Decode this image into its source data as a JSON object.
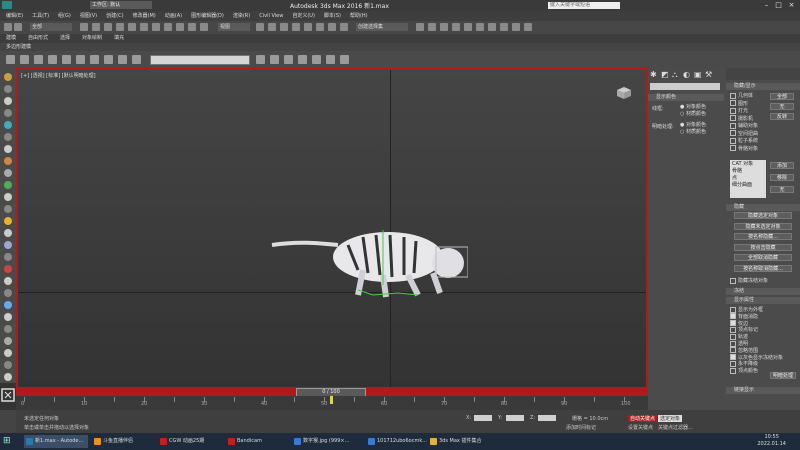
{
  "app": {
    "title": "Autodesk 3ds Max 2016    新1.max",
    "workspace_label": "工作区: 默认",
    "search_placeholder": "键入关键字或短语"
  },
  "menu": [
    "编辑(E)",
    "工具(T)",
    "组(G)",
    "视图(V)",
    "创建(C)",
    "修改器(M)",
    "动画(A)",
    "图形编辑器(D)",
    "渲染(R)",
    "Civil View",
    "自定义(U)",
    "脚本(S)",
    "帮助(H)"
  ],
  "toolbar1": {
    "select_value": "全部",
    "view_value": "视图",
    "selection_set": "创建选择集"
  },
  "ribbon_tabs": [
    "建模",
    "自由形式",
    "选择",
    "对象绘制",
    "填充"
  ],
  "subbar_label": "多边形建模",
  "viewport": {
    "label": "[+] [透视] [标准] [默认明暗处理]",
    "accent": "#b01a1a"
  },
  "timeline": {
    "slider_label": "0 / 100",
    "ticks": [
      "0",
      "5",
      "10",
      "15",
      "20",
      "25",
      "30",
      "35",
      "40",
      "45",
      "50",
      "55",
      "60",
      "65",
      "70",
      "75",
      "80",
      "85",
      "90",
      "95",
      "100"
    ]
  },
  "status": {
    "line1": "未选定任何对象",
    "line2": "单击或单击并拖动以选择对象",
    "x_label": "X:",
    "y_label": "Y:",
    "z_label": "Z:",
    "grid": "栅格 = 10.0cm",
    "add_time_tag": "添加时间标记",
    "auto_key": "自动关键点",
    "selected": "选定对象",
    "set_key": "设置关键点",
    "key_filter": "关键点过滤器..."
  },
  "command_panel": {
    "rollout_title": "显示颜色",
    "wire_label": "线框:",
    "shaded_label": "明暗处理:",
    "opt_object_color": "对象颜色",
    "opt_material_color": "材质颜色"
  },
  "right_panel": {
    "section1_title": "隐藏/显示",
    "items1": [
      "几何体",
      "图形",
      "灯光",
      "摄影机",
      "辅助对象",
      "空间扭曲",
      "粒子系统",
      "骨骼对象"
    ],
    "btn_all": "全部",
    "btn_none": "无",
    "btn_invert": "反转",
    "list_head": "CAT 对象",
    "list_items": [
      "骨骼",
      "点",
      "细分曲面"
    ],
    "btn_add": "添加",
    "btn_remove": "移除",
    "btn_none2": "无",
    "section2_title": "隐藏",
    "hide_buttons": [
      "隐藏选定对象",
      "隐藏未选定对象",
      "按名称隐藏...",
      "按点击隐藏",
      "全部取消隐藏",
      "按名称取消隐藏..."
    ],
    "freeze_title": "隐藏冻结对象",
    "section3_title": "冻结",
    "section4_title": "显示属性",
    "display_props": [
      {
        "label": "显示为外框",
        "checked": false
      },
      {
        "label": "背面消隐",
        "checked": true
      },
      {
        "label": "仅边",
        "checked": true
      },
      {
        "label": "顶点标记",
        "checked": false
      },
      {
        "label": "轨迹",
        "checked": false
      },
      {
        "label": "透明",
        "checked": false
      },
      {
        "label": "忽略范围",
        "checked": false
      },
      {
        "label": "以灰色显示冻结对象",
        "checked": true
      },
      {
        "label": "永不降级",
        "checked": false
      },
      {
        "label": "顶点颜色",
        "checked": false
      }
    ],
    "shading_btn": "明暗处理",
    "link_display_title": "链接显示"
  },
  "taskbar": {
    "tasks": [
      {
        "label": "新1.max - Autode...",
        "active": true,
        "color": "#2a7ab0"
      },
      {
        "label": "斗鱼直播伴侣",
        "active": false,
        "color": "#e89020"
      },
      {
        "label": "CGW 动画25期",
        "active": false,
        "color": "#c02020"
      },
      {
        "label": "Bandicam",
        "active": false,
        "color": "#c02020"
      },
      {
        "label": "数字猴.jpg (999×...",
        "active": false,
        "color": "#3a7ad0"
      },
      {
        "label": "101712ubo6ocmk...",
        "active": false,
        "color": "#3a7ad0"
      },
      {
        "label": "3ds Max 插件集合",
        "active": false,
        "color": "#e0b040"
      }
    ],
    "time": "10:55",
    "date": "2022.01.14"
  }
}
